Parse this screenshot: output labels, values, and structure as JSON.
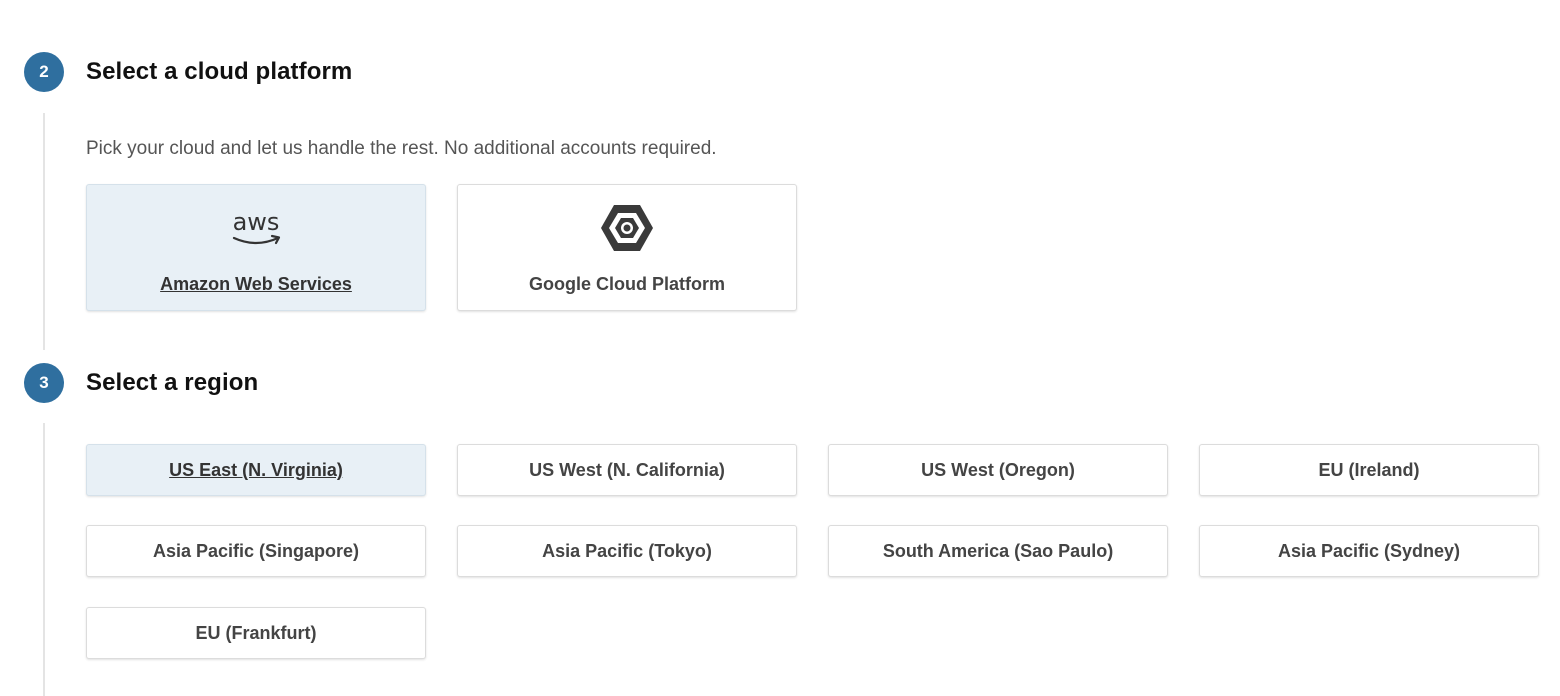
{
  "steps": {
    "cloud": {
      "number": "2",
      "title": "Select a cloud platform",
      "description": "Pick your cloud and let us handle the rest. No additional accounts required."
    },
    "region": {
      "number": "3",
      "title": "Select a region"
    }
  },
  "providers": [
    {
      "label": "Amazon Web Services",
      "logo_text": "aws",
      "icon": "aws-logo-icon",
      "selected": true
    },
    {
      "label": "Google Cloud Platform",
      "icon": "google-cloud-hexagon-icon",
      "selected": false
    }
  ],
  "regions": [
    {
      "label": "US East (N. Virginia)",
      "selected": true
    },
    {
      "label": "US West (N. California)",
      "selected": false
    },
    {
      "label": "US West (Oregon)",
      "selected": false
    },
    {
      "label": "EU (Ireland)",
      "selected": false
    },
    {
      "label": "Asia Pacific (Singapore)",
      "selected": false
    },
    {
      "label": "Asia Pacific (Tokyo)",
      "selected": false
    },
    {
      "label": "South America (Sao Paulo)",
      "selected": false
    },
    {
      "label": "Asia Pacific (Sydney)",
      "selected": false
    },
    {
      "label": "EU (Frankfurt)",
      "selected": false
    }
  ],
  "colors": {
    "accent": "#2f6f9f",
    "selected_bg": "#e8f0f6",
    "card_border": "#dcdcdc",
    "step_line": "#e4e4e4"
  }
}
